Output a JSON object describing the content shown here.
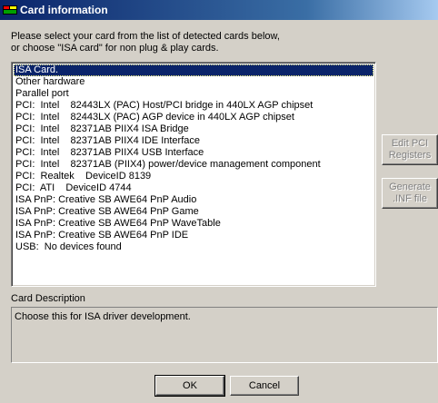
{
  "window": {
    "title": "Card information",
    "icon": "app-icon"
  },
  "instructions": {
    "line1": "Please select your card from the list of detected cards below,",
    "line2": "or choose \"ISA card\" for non plug & play cards."
  },
  "card_list": {
    "selected_index": 0,
    "items": [
      "ISA Card.",
      "Other hardware",
      "Parallel port",
      "PCI:  Intel    82443LX (PAC) Host/PCI bridge in 440LX AGP chipset",
      "PCI:  Intel    82443LX (PAC) AGP device in 440LX AGP chipset",
      "PCI:  Intel    82371AB PIIX4 ISA Bridge",
      "PCI:  Intel    82371AB PIIX4 IDE Interface",
      "PCI:  Intel    82371AB PIIX4 USB Interface",
      "PCI:  Intel    82371AB (PIIX4) power/device management component",
      "PCI:  Realtek    DeviceID 8139",
      "PCI:  ATI    DeviceID 4744",
      "ISA PnP: Creative SB AWE64 PnP Audio",
      "ISA PnP: Creative SB AWE64 PnP Game",
      "ISA PnP: Creative SB AWE64 PnP WaveTable",
      "ISA PnP: Creative SB AWE64 PnP IDE",
      "USB:  No devices found"
    ]
  },
  "side_buttons": {
    "edit_pci_line1": "Edit PCI",
    "edit_pci_line2": "Registers",
    "generate_inf_line1": "Generate",
    "generate_inf_line2": ".INF file"
  },
  "description": {
    "label": "Card Description",
    "text": "Choose this for ISA driver development."
  },
  "footer": {
    "ok_label": "OK",
    "cancel_label": "Cancel"
  }
}
